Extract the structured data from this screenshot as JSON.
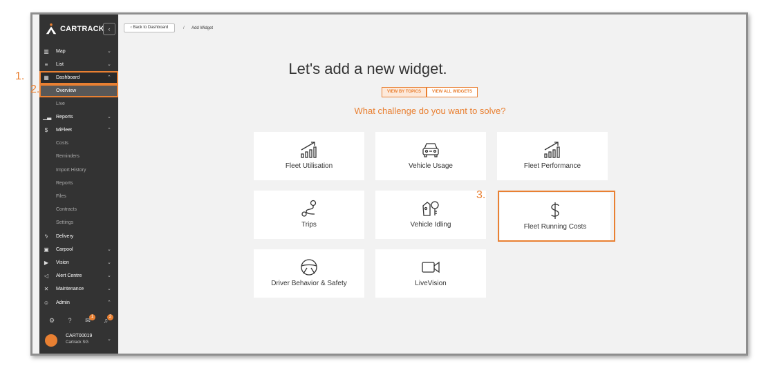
{
  "brand": {
    "name": "CARTRACK",
    "accent": "#e98032",
    "sidebar_bg": "#333333"
  },
  "sidebar": {
    "items": [
      {
        "label": "Map",
        "icon": "map-icon"
      },
      {
        "label": "List",
        "icon": "list-icon"
      },
      {
        "label": "Dashboard",
        "icon": "dashboard-icon"
      },
      {
        "label": "Overview"
      },
      {
        "label": "Live"
      },
      {
        "label": "Reports",
        "icon": "bar-chart-icon"
      },
      {
        "label": "MiFleet",
        "icon": "dollar-icon"
      },
      {
        "label": "Costs"
      },
      {
        "label": "Reminders"
      },
      {
        "label": "Import History"
      },
      {
        "label": "Reports"
      },
      {
        "label": "Files"
      },
      {
        "label": "Contracts"
      },
      {
        "label": "Settings"
      },
      {
        "label": "Delivery",
        "icon": "bolt-icon"
      },
      {
        "label": "Carpool",
        "icon": "calendar-icon"
      },
      {
        "label": "Vision",
        "icon": "camera-icon"
      },
      {
        "label": "Alert Centre",
        "icon": "megaphone-icon"
      },
      {
        "label": "Maintenance",
        "icon": "tools-icon"
      },
      {
        "label": "Admin",
        "icon": "users-icon"
      }
    ],
    "badges": {
      "notifications": "1",
      "alerts": "2"
    },
    "user": {
      "id": "CART00019",
      "org": "Cartrack SG"
    }
  },
  "breadcrumb": {
    "back": "Back to Dashboard",
    "sep": "/",
    "current": "Add Widget"
  },
  "main": {
    "headline": "Let's add a new widget.",
    "tabs": [
      {
        "label": "VIEW BY TOPICS"
      },
      {
        "label": "VIEW ALL WIDGETS"
      }
    ],
    "question": "What challenge do you want to solve?",
    "cards": [
      {
        "label": "Fleet Utilisation",
        "icon": "growth-chart-icon"
      },
      {
        "label": "Vehicle Usage",
        "icon": "car-icon"
      },
      {
        "label": "Fleet Performance",
        "icon": "growth-chart-icon"
      },
      {
        "label": "Trips",
        "icon": "route-icon"
      },
      {
        "label": "Vehicle Idling",
        "icon": "engine-key-icon"
      },
      {
        "label": "Fleet Running Costs",
        "icon": "dollar-icon"
      },
      {
        "label": "Driver Behavior & Safety",
        "icon": "steering-wheel-icon"
      },
      {
        "label": "LiveVision",
        "icon": "video-camera-icon"
      }
    ]
  },
  "steps": [
    "1.",
    "2.",
    "3."
  ]
}
